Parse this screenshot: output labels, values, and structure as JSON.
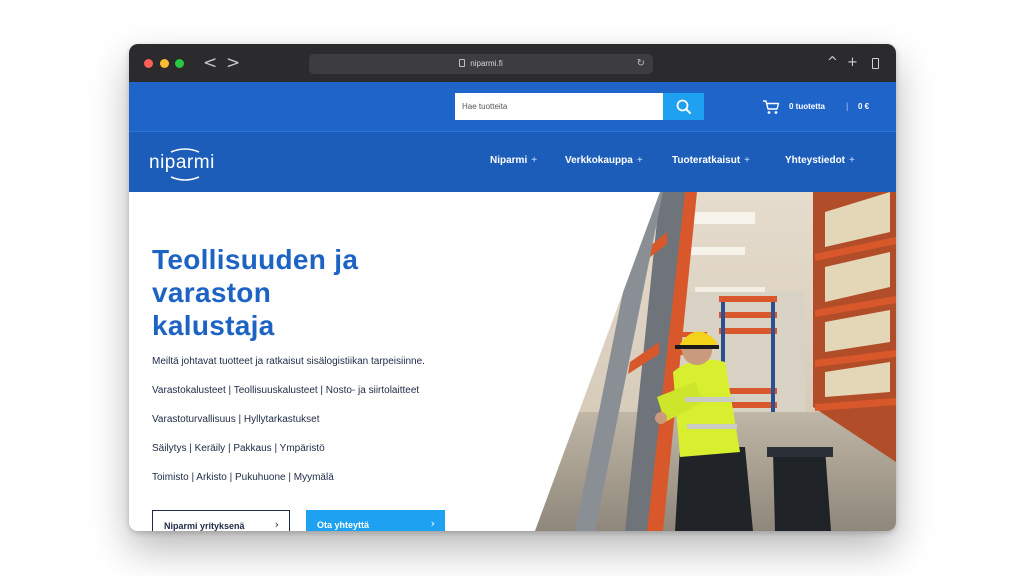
{
  "browser": {
    "url": "niparmi.fi",
    "back_icon": "<",
    "forward_icon": ">",
    "reload_icon": "↻",
    "share_icon": "^",
    "new_tab_icon": "+"
  },
  "header": {
    "search_placeholder": "Hae tuotteita",
    "cart_count": "0 tuotetta",
    "cart_separator": "|",
    "cart_total": "0 €"
  },
  "nav": {
    "logo": "niparmi",
    "items": [
      {
        "label": "Niparmi",
        "plus": "+"
      },
      {
        "label": "Verkkokauppa",
        "plus": "+"
      },
      {
        "label": "Tuoteratkaisut",
        "plus": "+"
      },
      {
        "label": "Yhteystiedot",
        "plus": "+"
      }
    ]
  },
  "hero": {
    "headline_lines": [
      "Teollisuuden ja",
      "varaston",
      "kalustaja"
    ],
    "lead": "Meiltä johtavat tuotteet ja ratkaisut sisälogistiikan tarpeisiinne.",
    "links": [
      "Varastokalusteet | Teollisuuskalusteet | Nosto- ja siirtolaitteet",
      "Varastoturvallisuus | Hyllytarkastukset",
      "Säilytys | Keräily | Pakkaus | Ympäristö",
      "Toimisto | Arkisto | Pukuhuone | Myymälä"
    ],
    "button_primary": "Niparmi yrityksenä",
    "button_secondary": "Ota yhteyttä",
    "chevron": "›"
  },
  "colors": {
    "brand_blue": "#1f64c9",
    "accent_cyan": "#1ea1f0",
    "headline_blue": "#1d63c4",
    "text_dark": "#1d2a44"
  }
}
